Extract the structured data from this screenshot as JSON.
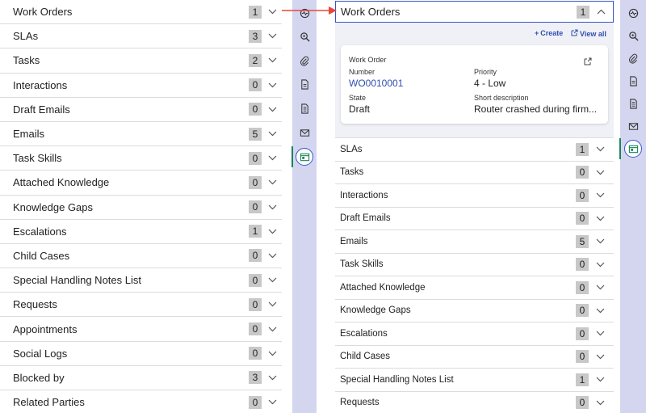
{
  "left_list": [
    {
      "label": "Work Orders",
      "count": "1"
    },
    {
      "label": "SLAs",
      "count": "3"
    },
    {
      "label": "Tasks",
      "count": "2"
    },
    {
      "label": "Interactions",
      "count": "0"
    },
    {
      "label": "Draft Emails",
      "count": "0"
    },
    {
      "label": "Emails",
      "count": "5"
    },
    {
      "label": "Task Skills",
      "count": "0"
    },
    {
      "label": "Attached Knowledge",
      "count": "0"
    },
    {
      "label": "Knowledge Gaps",
      "count": "0"
    },
    {
      "label": "Escalations",
      "count": "1"
    },
    {
      "label": "Child Cases",
      "count": "0"
    },
    {
      "label": "Special Handling Notes List",
      "count": "0"
    },
    {
      "label": "Requests",
      "count": "0"
    },
    {
      "label": "Appointments",
      "count": "0"
    },
    {
      "label": "Social Logs",
      "count": "0"
    },
    {
      "label": "Blocked by",
      "count": "3"
    },
    {
      "label": "Related Parties",
      "count": "0"
    }
  ],
  "rail_icons": [
    "activity-icon",
    "search-knowledge-icon",
    "paperclip-icon",
    "document-icon",
    "document-lines-icon",
    "envelope-icon",
    "related-lists-icon"
  ],
  "work_orders": {
    "label": "Work Orders",
    "count": "1",
    "create_label": "Create",
    "view_all_label": "View all",
    "card": {
      "title": "Work Order",
      "number_label": "Number",
      "number_value": "WO0010001",
      "priority_label": "Priority",
      "priority_value": "4 - Low",
      "state_label": "State",
      "state_value": "Draft",
      "short_desc_label": "Short description",
      "short_desc_value": "Router crashed during firm..."
    }
  },
  "right_list": [
    {
      "label": "SLAs",
      "count": "1"
    },
    {
      "label": "Tasks",
      "count": "0"
    },
    {
      "label": "Interactions",
      "count": "0"
    },
    {
      "label": "Draft Emails",
      "count": "0"
    },
    {
      "label": "Emails",
      "count": "5"
    },
    {
      "label": "Task Skills",
      "count": "0"
    },
    {
      "label": "Attached Knowledge",
      "count": "0"
    },
    {
      "label": "Knowledge Gaps",
      "count": "0"
    },
    {
      "label": "Escalations",
      "count": "0"
    },
    {
      "label": "Child Cases",
      "count": "0"
    },
    {
      "label": "Special Handling Notes List",
      "count": "1"
    },
    {
      "label": "Requests",
      "count": "0"
    }
  ],
  "colors": {
    "accent": "#3a55c8",
    "link": "#2d4fae",
    "rail": "#d4d6f0",
    "annotation_arrow": "#e8463a"
  }
}
